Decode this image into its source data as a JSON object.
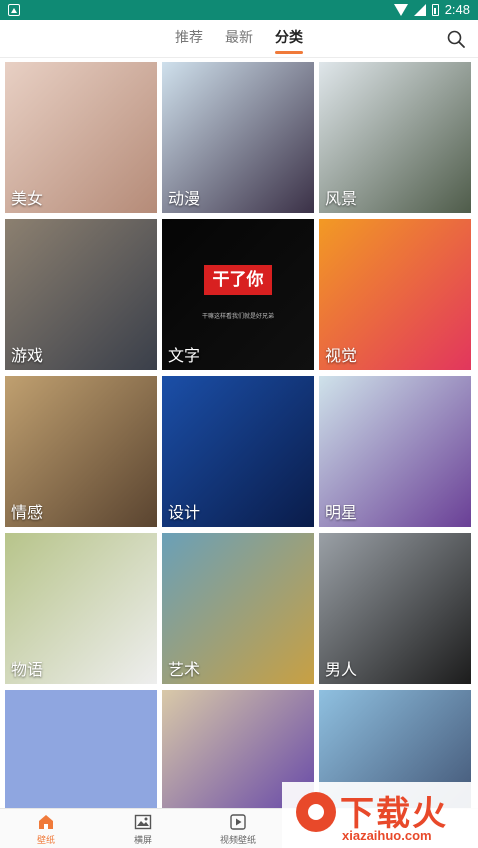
{
  "status_bar": {
    "time": "2:48"
  },
  "header": {
    "tabs": [
      {
        "label": "推荐",
        "active": false
      },
      {
        "label": "最新",
        "active": false
      },
      {
        "label": "分类",
        "active": true
      }
    ],
    "search_icon": "search-icon"
  },
  "categories": [
    {
      "label": "美女",
      "colors": [
        "#e8d0c4",
        "#b58b78"
      ]
    },
    {
      "label": "动漫",
      "colors": [
        "#cfe0ec",
        "#3b3147"
      ]
    },
    {
      "label": "风景",
      "colors": [
        "#dfe6ea",
        "#4f5c4a"
      ]
    },
    {
      "label": "游戏",
      "colors": [
        "#8c8070",
        "#3a3f4a"
      ]
    },
    {
      "label": "文字",
      "colors": [
        "#050505",
        "#101010"
      ],
      "badge": "干了你",
      "caption": "干嘛这样看我们就是好兄弟"
    },
    {
      "label": "视觉",
      "colors": [
        "#f29a24",
        "#e2365d"
      ]
    },
    {
      "label": "情感",
      "colors": [
        "#c0a070",
        "#5a4430"
      ]
    },
    {
      "label": "设计",
      "colors": [
        "#1b4fa8",
        "#0a1c4a"
      ]
    },
    {
      "label": "明星",
      "colors": [
        "#cfe2ea",
        "#6a3f96"
      ]
    },
    {
      "label": "物语",
      "colors": [
        "#b7c48a",
        "#eeeeee"
      ]
    },
    {
      "label": "艺术",
      "colors": [
        "#6aa0b8",
        "#c8a043"
      ]
    },
    {
      "label": "男人",
      "colors": [
        "#9aa0a6",
        "#1c1c1c"
      ]
    },
    {
      "label": "",
      "colors": [
        "#8fa6e0",
        "#8fa6e0"
      ]
    },
    {
      "label": "",
      "colors": [
        "#d9c9a8",
        "#5a3aa8"
      ]
    },
    {
      "label": "",
      "colors": [
        "#8fc0e0",
        "#3a4a6a"
      ]
    }
  ],
  "bottom_nav": [
    {
      "label": "壁纸",
      "icon": "home-icon",
      "active": true
    },
    {
      "label": "横屏",
      "icon": "image-icon",
      "active": false
    },
    {
      "label": "视频壁纸",
      "icon": "video-icon",
      "active": false
    }
  ],
  "watermark": {
    "title": "下载火",
    "subtitle": "xiazaihuo.com"
  }
}
